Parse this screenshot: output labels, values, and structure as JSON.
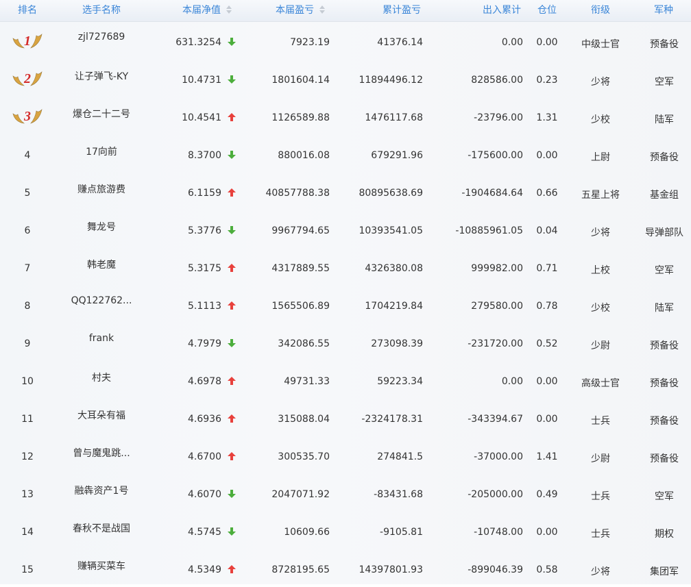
{
  "header": {
    "rank": "排名",
    "name": "选手名称",
    "nav": "本届净值",
    "profit": "本届盈亏",
    "cum_profit": "累计盈亏",
    "flow": "出入累计",
    "position": "仓位",
    "title": "衔级",
    "branch": "军种"
  },
  "colors": {
    "header_text": "#3b86d8",
    "up": "#e8413c",
    "down": "#4cae3c",
    "medal_gold": "#d9a441",
    "medal_num": "#d42a2a"
  },
  "rows": [
    {
      "rank": "1",
      "name": "zjl727689",
      "nav": "631.3254",
      "dir": "down",
      "profit": "7923.19",
      "cum": "41376.14",
      "flow": "0.00",
      "pos": "0.00",
      "title": "中级士官",
      "branch": "预备役"
    },
    {
      "rank": "2",
      "name": "让子弹飞-KY",
      "nav": "10.4731",
      "dir": "down",
      "profit": "1801604.14",
      "cum": "11894496.12",
      "flow": "828586.00",
      "pos": "0.23",
      "title": "少将",
      "branch": "空军"
    },
    {
      "rank": "3",
      "name": "爆仓二十二号",
      "nav": "10.4541",
      "dir": "up",
      "profit": "1126589.88",
      "cum": "1476117.68",
      "flow": "-23796.00",
      "pos": "1.31",
      "title": "少校",
      "branch": "陆军"
    },
    {
      "rank": "4",
      "name": "17向前",
      "nav": "8.3700",
      "dir": "down",
      "profit": "880016.08",
      "cum": "679291.96",
      "flow": "-175600.00",
      "pos": "0.00",
      "title": "上尉",
      "branch": "预备役"
    },
    {
      "rank": "5",
      "name": "赚点旅游费",
      "nav": "6.1159",
      "dir": "up",
      "profit": "40857788.38",
      "cum": "80895638.69",
      "flow": "-1904684.64",
      "pos": "0.66",
      "title": "五星上将",
      "branch": "基金组"
    },
    {
      "rank": "6",
      "name": "舞龙号",
      "nav": "5.3776",
      "dir": "down",
      "profit": "9967794.65",
      "cum": "10393541.05",
      "flow": "-10885961.05",
      "pos": "0.04",
      "title": "少将",
      "branch": "导弹部队"
    },
    {
      "rank": "7",
      "name": "韩老魔",
      "nav": "5.3175",
      "dir": "up",
      "profit": "4317889.55",
      "cum": "4326380.08",
      "flow": "999982.00",
      "pos": "0.71",
      "title": "上校",
      "branch": "空军"
    },
    {
      "rank": "8",
      "name": "QQ122762...",
      "nav": "5.1113",
      "dir": "up",
      "profit": "1565506.89",
      "cum": "1704219.84",
      "flow": "279580.00",
      "pos": "0.78",
      "title": "少校",
      "branch": "陆军"
    },
    {
      "rank": "9",
      "name": "frank",
      "nav": "4.7979",
      "dir": "down",
      "profit": "342086.55",
      "cum": "273098.39",
      "flow": "-231720.00",
      "pos": "0.52",
      "title": "少尉",
      "branch": "预备役"
    },
    {
      "rank": "10",
      "name": "村夫",
      "nav": "4.6978",
      "dir": "up",
      "profit": "49731.33",
      "cum": "59223.34",
      "flow": "0.00",
      "pos": "0.00",
      "title": "高级士官",
      "branch": "预备役"
    },
    {
      "rank": "11",
      "name": "大耳朵有福",
      "nav": "4.6936",
      "dir": "up",
      "profit": "315088.04",
      "cum": "-2324178.31",
      "flow": "-343394.67",
      "pos": "0.00",
      "title": "士兵",
      "branch": "预备役"
    },
    {
      "rank": "12",
      "name": "曾与魔鬼跳...",
      "nav": "4.6700",
      "dir": "up",
      "profit": "300535.70",
      "cum": "274841.5",
      "flow": "-37000.00",
      "pos": "1.41",
      "title": "少尉",
      "branch": "预备役"
    },
    {
      "rank": "13",
      "name": "融犇资产1号",
      "nav": "4.6070",
      "dir": "down",
      "profit": "2047071.92",
      "cum": "-83431.68",
      "flow": "-205000.00",
      "pos": "0.49",
      "title": "士兵",
      "branch": "空军"
    },
    {
      "rank": "14",
      "name": "春秋不是战国",
      "nav": "4.5745",
      "dir": "down",
      "profit": "10609.66",
      "cum": "-9105.81",
      "flow": "-10748.00",
      "pos": "0.00",
      "title": "士兵",
      "branch": "期权"
    },
    {
      "rank": "15",
      "name": "赚辆买菜车",
      "nav": "4.5349",
      "dir": "up",
      "profit": "8728195.65",
      "cum": "14397801.93",
      "flow": "-899046.39",
      "pos": "0.58",
      "title": "少将",
      "branch": "集团军"
    }
  ]
}
